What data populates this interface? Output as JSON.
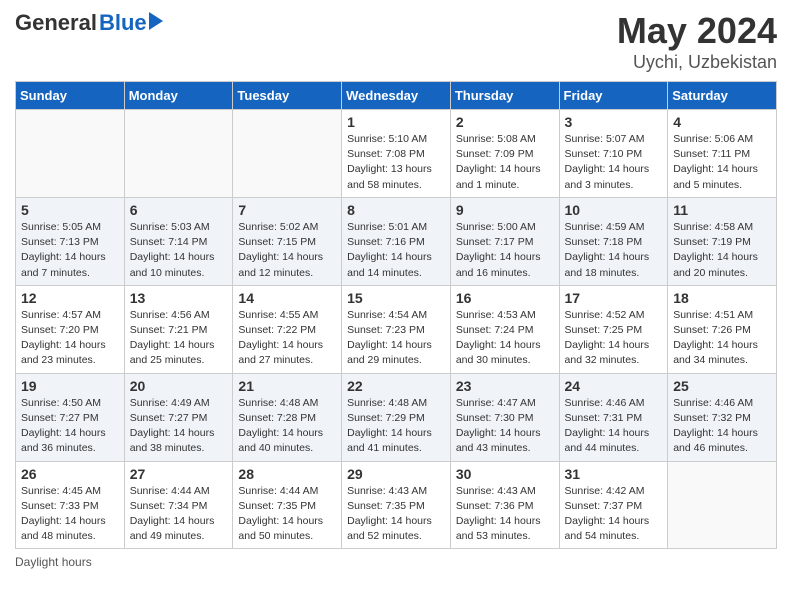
{
  "logo": {
    "general": "General",
    "blue": "Blue"
  },
  "header": {
    "month": "May 2024",
    "location": "Uychi, Uzbekistan"
  },
  "weekdays": [
    "Sunday",
    "Monday",
    "Tuesday",
    "Wednesday",
    "Thursday",
    "Friday",
    "Saturday"
  ],
  "weeks": [
    [
      {
        "day": "",
        "sunrise": "",
        "sunset": "",
        "daylight": ""
      },
      {
        "day": "",
        "sunrise": "",
        "sunset": "",
        "daylight": ""
      },
      {
        "day": "",
        "sunrise": "",
        "sunset": "",
        "daylight": ""
      },
      {
        "day": "1",
        "sunrise": "Sunrise: 5:10 AM",
        "sunset": "Sunset: 7:08 PM",
        "daylight": "Daylight: 13 hours and 58 minutes."
      },
      {
        "day": "2",
        "sunrise": "Sunrise: 5:08 AM",
        "sunset": "Sunset: 7:09 PM",
        "daylight": "Daylight: 14 hours and 1 minute."
      },
      {
        "day": "3",
        "sunrise": "Sunrise: 5:07 AM",
        "sunset": "Sunset: 7:10 PM",
        "daylight": "Daylight: 14 hours and 3 minutes."
      },
      {
        "day": "4",
        "sunrise": "Sunrise: 5:06 AM",
        "sunset": "Sunset: 7:11 PM",
        "daylight": "Daylight: 14 hours and 5 minutes."
      }
    ],
    [
      {
        "day": "5",
        "sunrise": "Sunrise: 5:05 AM",
        "sunset": "Sunset: 7:13 PM",
        "daylight": "Daylight: 14 hours and 7 minutes."
      },
      {
        "day": "6",
        "sunrise": "Sunrise: 5:03 AM",
        "sunset": "Sunset: 7:14 PM",
        "daylight": "Daylight: 14 hours and 10 minutes."
      },
      {
        "day": "7",
        "sunrise": "Sunrise: 5:02 AM",
        "sunset": "Sunset: 7:15 PM",
        "daylight": "Daylight: 14 hours and 12 minutes."
      },
      {
        "day": "8",
        "sunrise": "Sunrise: 5:01 AM",
        "sunset": "Sunset: 7:16 PM",
        "daylight": "Daylight: 14 hours and 14 minutes."
      },
      {
        "day": "9",
        "sunrise": "Sunrise: 5:00 AM",
        "sunset": "Sunset: 7:17 PM",
        "daylight": "Daylight: 14 hours and 16 minutes."
      },
      {
        "day": "10",
        "sunrise": "Sunrise: 4:59 AM",
        "sunset": "Sunset: 7:18 PM",
        "daylight": "Daylight: 14 hours and 18 minutes."
      },
      {
        "day": "11",
        "sunrise": "Sunrise: 4:58 AM",
        "sunset": "Sunset: 7:19 PM",
        "daylight": "Daylight: 14 hours and 20 minutes."
      }
    ],
    [
      {
        "day": "12",
        "sunrise": "Sunrise: 4:57 AM",
        "sunset": "Sunset: 7:20 PM",
        "daylight": "Daylight: 14 hours and 23 minutes."
      },
      {
        "day": "13",
        "sunrise": "Sunrise: 4:56 AM",
        "sunset": "Sunset: 7:21 PM",
        "daylight": "Daylight: 14 hours and 25 minutes."
      },
      {
        "day": "14",
        "sunrise": "Sunrise: 4:55 AM",
        "sunset": "Sunset: 7:22 PM",
        "daylight": "Daylight: 14 hours and 27 minutes."
      },
      {
        "day": "15",
        "sunrise": "Sunrise: 4:54 AM",
        "sunset": "Sunset: 7:23 PM",
        "daylight": "Daylight: 14 hours and 29 minutes."
      },
      {
        "day": "16",
        "sunrise": "Sunrise: 4:53 AM",
        "sunset": "Sunset: 7:24 PM",
        "daylight": "Daylight: 14 hours and 30 minutes."
      },
      {
        "day": "17",
        "sunrise": "Sunrise: 4:52 AM",
        "sunset": "Sunset: 7:25 PM",
        "daylight": "Daylight: 14 hours and 32 minutes."
      },
      {
        "day": "18",
        "sunrise": "Sunrise: 4:51 AM",
        "sunset": "Sunset: 7:26 PM",
        "daylight": "Daylight: 14 hours and 34 minutes."
      }
    ],
    [
      {
        "day": "19",
        "sunrise": "Sunrise: 4:50 AM",
        "sunset": "Sunset: 7:27 PM",
        "daylight": "Daylight: 14 hours and 36 minutes."
      },
      {
        "day": "20",
        "sunrise": "Sunrise: 4:49 AM",
        "sunset": "Sunset: 7:27 PM",
        "daylight": "Daylight: 14 hours and 38 minutes."
      },
      {
        "day": "21",
        "sunrise": "Sunrise: 4:48 AM",
        "sunset": "Sunset: 7:28 PM",
        "daylight": "Daylight: 14 hours and 40 minutes."
      },
      {
        "day": "22",
        "sunrise": "Sunrise: 4:48 AM",
        "sunset": "Sunset: 7:29 PM",
        "daylight": "Daylight: 14 hours and 41 minutes."
      },
      {
        "day": "23",
        "sunrise": "Sunrise: 4:47 AM",
        "sunset": "Sunset: 7:30 PM",
        "daylight": "Daylight: 14 hours and 43 minutes."
      },
      {
        "day": "24",
        "sunrise": "Sunrise: 4:46 AM",
        "sunset": "Sunset: 7:31 PM",
        "daylight": "Daylight: 14 hours and 44 minutes."
      },
      {
        "day": "25",
        "sunrise": "Sunrise: 4:46 AM",
        "sunset": "Sunset: 7:32 PM",
        "daylight": "Daylight: 14 hours and 46 minutes."
      }
    ],
    [
      {
        "day": "26",
        "sunrise": "Sunrise: 4:45 AM",
        "sunset": "Sunset: 7:33 PM",
        "daylight": "Daylight: 14 hours and 48 minutes."
      },
      {
        "day": "27",
        "sunrise": "Sunrise: 4:44 AM",
        "sunset": "Sunset: 7:34 PM",
        "daylight": "Daylight: 14 hours and 49 minutes."
      },
      {
        "day": "28",
        "sunrise": "Sunrise: 4:44 AM",
        "sunset": "Sunset: 7:35 PM",
        "daylight": "Daylight: 14 hours and 50 minutes."
      },
      {
        "day": "29",
        "sunrise": "Sunrise: 4:43 AM",
        "sunset": "Sunset: 7:35 PM",
        "daylight": "Daylight: 14 hours and 52 minutes."
      },
      {
        "day": "30",
        "sunrise": "Sunrise: 4:43 AM",
        "sunset": "Sunset: 7:36 PM",
        "daylight": "Daylight: 14 hours and 53 minutes."
      },
      {
        "day": "31",
        "sunrise": "Sunrise: 4:42 AM",
        "sunset": "Sunset: 7:37 PM",
        "daylight": "Daylight: 14 hours and 54 minutes."
      },
      {
        "day": "",
        "sunrise": "",
        "sunset": "",
        "daylight": ""
      }
    ]
  ],
  "footer": {
    "daylight_label": "Daylight hours"
  }
}
